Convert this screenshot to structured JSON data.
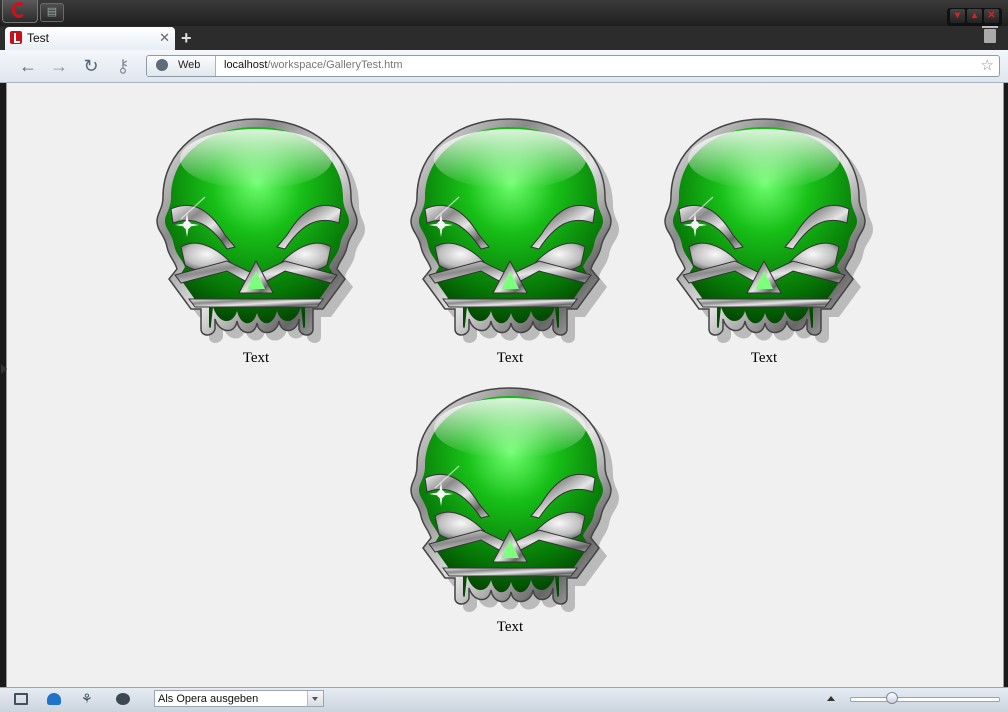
{
  "tabs": [
    {
      "title": "Test",
      "close_symbol": "✕"
    }
  ],
  "new_tab_symbol": "+",
  "toolbar": {
    "back_icon": "back-arrow-icon",
    "forward_icon": "forward-arrow-icon",
    "reload_icon": "reload-icon",
    "key_icon": "key-icon"
  },
  "address_bar": {
    "badge": "Web",
    "host": "localhost",
    "path": "/workspace/GalleryTest.htm"
  },
  "gallery": {
    "captions": [
      "Text",
      "Text",
      "Text",
      "Text"
    ]
  },
  "status_bar": {
    "identify_as": "Als Opera ausgeben",
    "zoom_fraction": 0.28
  },
  "colors": {
    "skull_green": "#16b316",
    "skull_dark": "#035f03",
    "chrome_silver": "#b7b7b7",
    "content_bg": "#f0f0f0"
  }
}
